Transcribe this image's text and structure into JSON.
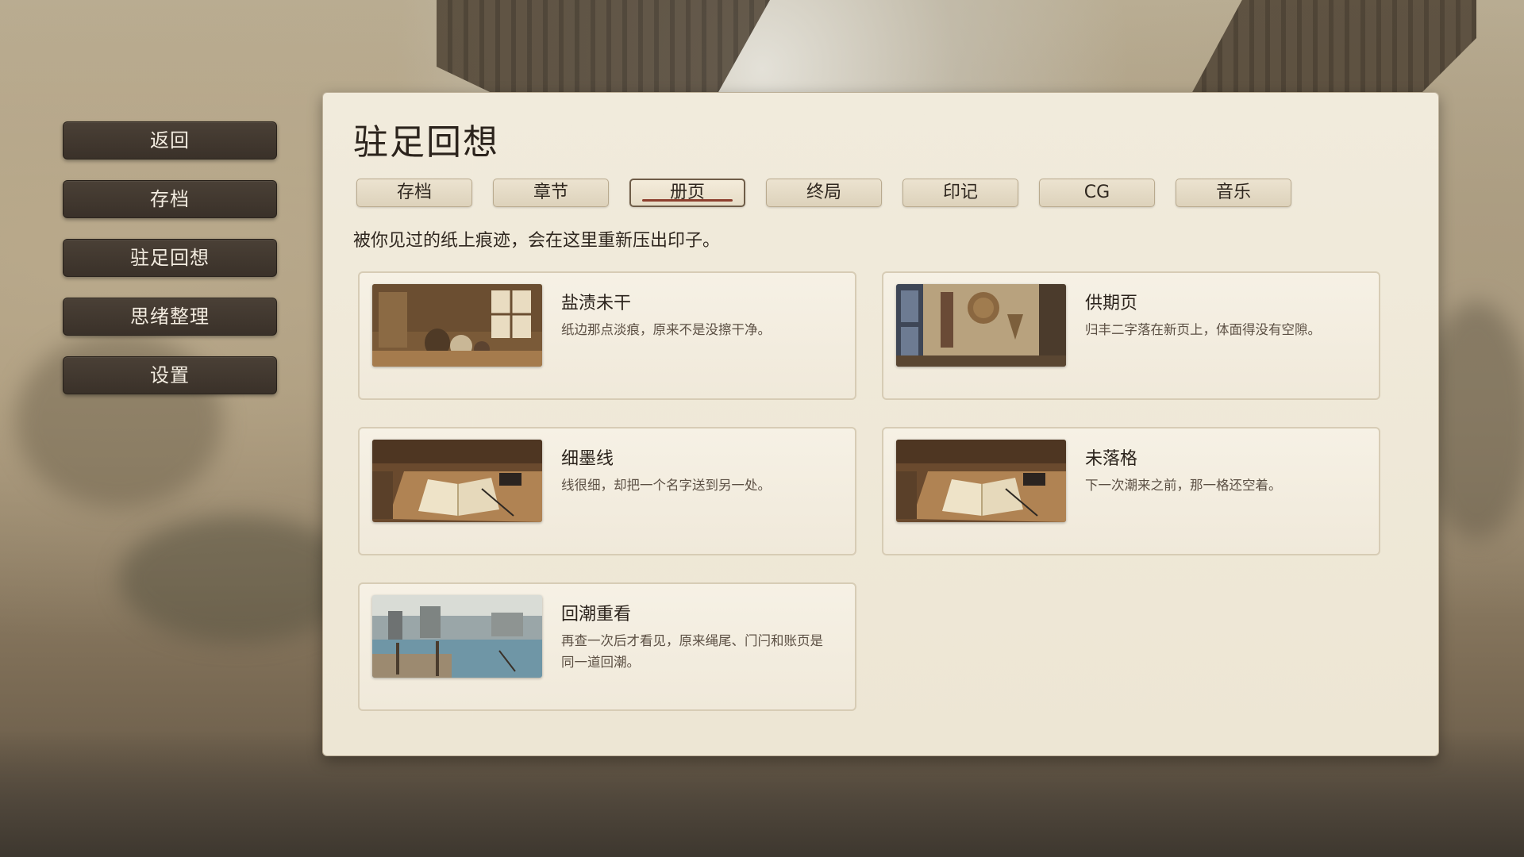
{
  "menu": {
    "items": [
      {
        "label": "返回"
      },
      {
        "label": "存档"
      },
      {
        "label": "驻足回想"
      },
      {
        "label": "思绪整理"
      },
      {
        "label": "设置"
      }
    ]
  },
  "panel": {
    "title": "驻足回想",
    "description": "被你见过的纸上痕迹，会在这里重新压出印子。",
    "active_tab": "册页",
    "tabs": [
      {
        "label": "存档"
      },
      {
        "label": "章节"
      },
      {
        "label": "册页"
      },
      {
        "label": "终局"
      },
      {
        "label": "印记"
      },
      {
        "label": "CG"
      },
      {
        "label": "音乐"
      }
    ],
    "cards": [
      {
        "title": "盐渍未干",
        "desc": "纸边那点淡痕，原来不是没擦干净。",
        "thumb": "kitchen-scene"
      },
      {
        "title": "供期页",
        "desc": "归丰二字落在新页上，体面得没有空隙。",
        "thumb": "wall-hangings-scene"
      },
      {
        "title": "细墨线",
        "desc": "线很细，却把一个名字送到另一处。",
        "thumb": "open-book-scene"
      },
      {
        "title": "未落格",
        "desc": "下一次潮来之前，那一格还空着。",
        "thumb": "open-book-scene"
      },
      {
        "title": "回潮重看",
        "desc": "再查一次后才看见，原来绳尾、门闩和账页是同一道回潮。",
        "thumb": "harbor-scene"
      }
    ]
  },
  "colors": {
    "menu_button": "#3f362d",
    "panel_bg": "#efe8d7",
    "tab_underline": "#8d3f2e",
    "card_border": "#d7ccb5"
  }
}
